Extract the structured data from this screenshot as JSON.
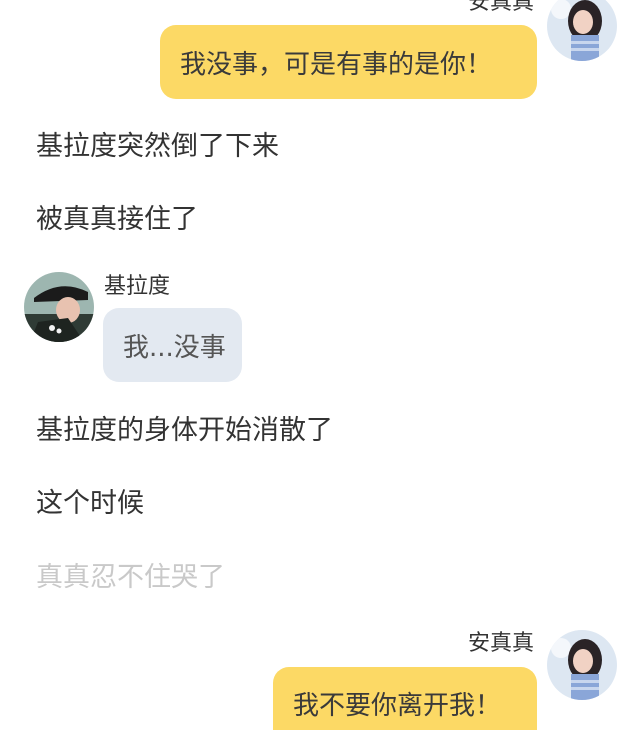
{
  "messages": [
    {
      "type": "user",
      "name": "安真真",
      "text": "我没事，可是有事的是你！"
    },
    {
      "type": "narration",
      "text": "基拉度突然倒了下来"
    },
    {
      "type": "narration",
      "text": "被真真接住了"
    },
    {
      "type": "other",
      "name": "基拉度",
      "text": "我...没事"
    },
    {
      "type": "narration",
      "text": "基拉度的身体开始消散了"
    },
    {
      "type": "narration",
      "text": "这个时候"
    },
    {
      "type": "narration",
      "text": "真真忍不住哭了",
      "faded": true
    },
    {
      "type": "user",
      "name": "安真真",
      "text": "我不要你离开我！"
    }
  ],
  "colors": {
    "user_bubble": "#fcd965",
    "other_bubble": "#e3e9f1",
    "text": "#333333",
    "faded_text": "#c9c9c9"
  },
  "icons": {
    "user_avatar": "girl-portrait-avatar",
    "other_avatar": "man-in-hat-portrait-avatar"
  }
}
